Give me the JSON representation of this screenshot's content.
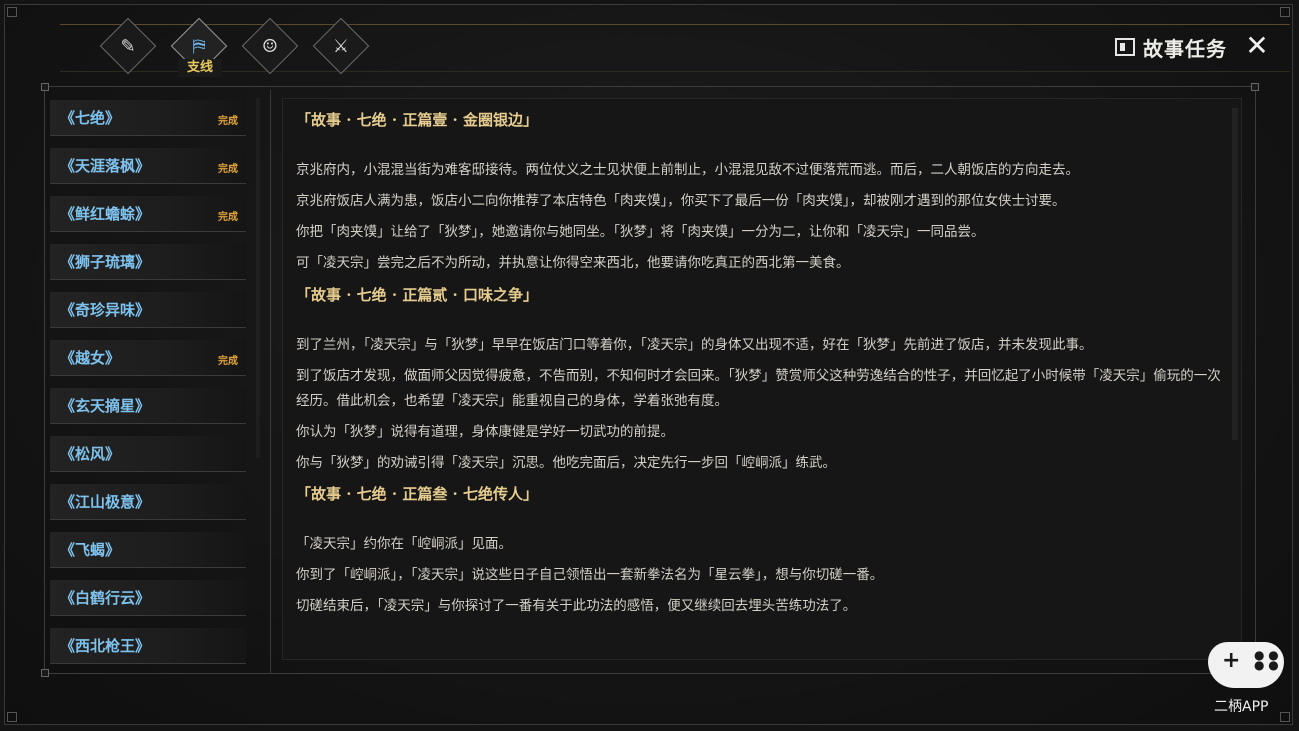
{
  "header": {
    "title": "故事任务",
    "close_glyph": "✕",
    "tabs": [
      {
        "icon": "scroll-quill-icon",
        "glyph": "✎",
        "label": "",
        "active": false
      },
      {
        "icon": "map-icon",
        "glyph": "⛿",
        "label": "支线",
        "active": true
      },
      {
        "icon": "portrait-icon",
        "glyph": "☺",
        "label": "",
        "active": false
      },
      {
        "icon": "crossed-swords-icon",
        "glyph": "⚔",
        "label": "",
        "active": false
      }
    ]
  },
  "sidebar": {
    "items": [
      {
        "label": "《七绝》",
        "status": "完成"
      },
      {
        "label": "《天涯落枫》",
        "status": "完成"
      },
      {
        "label": "《鲜红蟾蜍》",
        "status": "完成"
      },
      {
        "label": "《狮子琉璃》",
        "status": ""
      },
      {
        "label": "《奇珍异味》",
        "status": ""
      },
      {
        "label": "《越女》",
        "status": "完成"
      },
      {
        "label": "《玄天摘星》",
        "status": ""
      },
      {
        "label": "《松风》",
        "status": ""
      },
      {
        "label": "《江山极意》",
        "status": ""
      },
      {
        "label": "《飞蝎》",
        "status": ""
      },
      {
        "label": "《白鹤行云》",
        "status": ""
      },
      {
        "label": "《西北枪王》",
        "status": ""
      }
    ]
  },
  "content": {
    "sections": [
      {
        "title": "「故事 · 七绝 · 正篇壹 · 金圈银边」",
        "paragraphs": [
          "京兆府内，小混混当街为难客邸接待。两位仗义之士见状便上前制止，小混混见敌不过便落荒而逃。而后，二人朝饭店的方向走去。",
          "京兆府饭店人满为患，饭店小二向你推荐了本店特色「肉夹馍」，你买下了最后一份「肉夹馍」，却被刚才遇到的那位女侠士讨要。",
          "你把「肉夹馍」让给了「狄梦」，她邀请你与她同坐。「狄梦」将「肉夹馍」一分为二，让你和「凌天宗」一同品尝。",
          "可「凌天宗」尝完之后不为所动，并执意让你得空来西北，他要请你吃真正的西北第一美食。"
        ]
      },
      {
        "title": "「故事 · 七绝 · 正篇贰 · 口味之争」",
        "paragraphs": [
          "到了兰州，「凌天宗」与「狄梦」早早在饭店门口等着你，「凌天宗」的身体又出现不适，好在「狄梦」先前进了饭店，并未发现此事。",
          "到了饭店才发现，做面师父因觉得疲惫，不告而别，不知何时才会回来。「狄梦」赞赏师父这种劳逸结合的性子，并回忆起了小时候带「凌天宗」偷玩的一次经历。借此机会，也希望「凌天宗」能重视自己的身体，学着张弛有度。",
          "你认为「狄梦」说得有道理，身体康健是学好一切武功的前提。",
          "你与「狄梦」的劝诫引得「凌天宗」沉思。他吃完面后，决定先行一步回「崆峒派」练武。"
        ]
      },
      {
        "title": "「故事 · 七绝 · 正篇叁 · 七绝传人」",
        "paragraphs": [
          "「凌天宗」约你在「崆峒派」见面。",
          "你到了「崆峒派」，「凌天宗」说这些日子自己领悟出一套新拳法名为「星云拳」，想与你切磋一番。",
          "切磋结束后，「凌天宗」与你探讨了一番有关于此功法的感悟，便又继续回去埋头苦练功法了。"
        ]
      }
    ]
  },
  "watermark": {
    "text": "二柄APP"
  }
}
